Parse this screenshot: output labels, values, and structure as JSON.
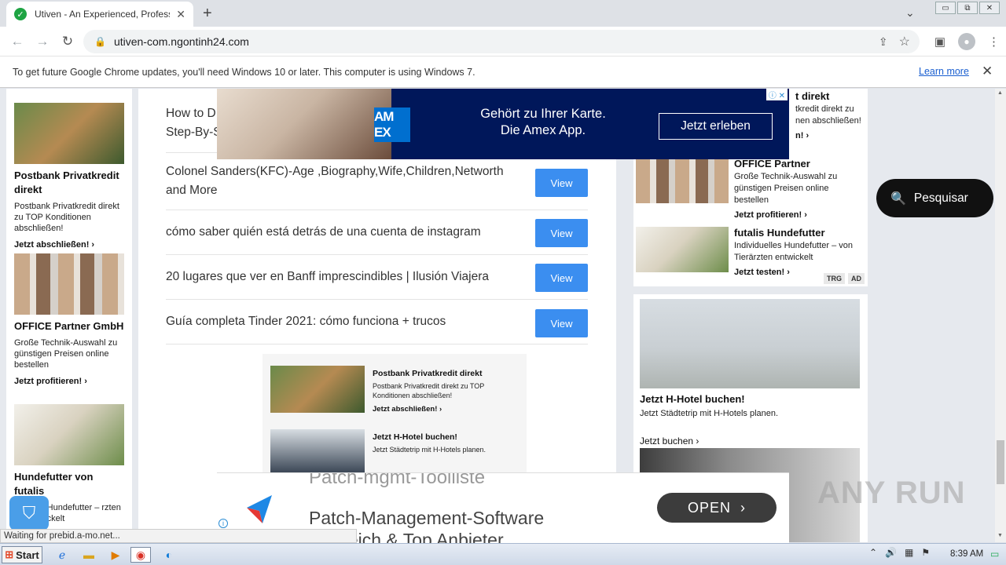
{
  "browser": {
    "tab_title": "Utiven - An Experienced, Profession",
    "url": "utiven-com.ngontinh24.com",
    "win_minimize": "▭",
    "win_restore": "⧉",
    "win_close": "✕"
  },
  "infobar": {
    "message": "To get future Google Chrome updates, you'll need Windows 10 or later. This computer is using Windows 7.",
    "learn_more": "Learn more"
  },
  "articles": [
    {
      "title": "How to D\nStep-By-S",
      "button": "View"
    },
    {
      "title": "Colonel Sanders(KFC)-Age ,Biography,Wife,Children,Networth and More",
      "button": "View"
    },
    {
      "title": "cómo saber quién está detrás de una cuenta de instagram",
      "button": "View"
    },
    {
      "title": "20 lugares que ver en Banff imprescindibles | Ilusión Viajera",
      "button": "View"
    },
    {
      "title": "Guía completa Tinder 2021: cómo funciona + trucos",
      "button": "View"
    }
  ],
  "left_ads": [
    {
      "heading": "Postbank Privatkredit direkt",
      "desc": "Postbank Privatkredit direkt zu TOP Konditionen abschließen!",
      "cta": "Jetzt abschließen!  ›"
    },
    {
      "heading": "OFFICE Partner GmbH",
      "desc": "Große Technik-Auswahl zu günstigen Preisen online bestellen",
      "cta": "Jetzt profitieren!  ›"
    },
    {
      "heading": "Hundefutter von futalis",
      "desc": "elles Hundefutter – rzten entwickelt",
      "cta": ""
    }
  ],
  "inline_ads": [
    {
      "heading": "Postbank Privatkredit direkt",
      "desc": "Postbank Privatkredit direkt zu TOP Konditionen abschließen!",
      "cta": "Jetzt abschließen!  ›"
    },
    {
      "heading": "Jetzt H-Hotel buchen!",
      "desc": "Jetzt Städtetrip mit H-Hotels planen.",
      "cta": ""
    }
  ],
  "right_ads": [
    {
      "heading": "t direkt",
      "desc": "tkredit direkt zu nen abschließen!",
      "cta": "n!  ›"
    },
    {
      "heading": "OFFICE Partner",
      "desc": "Große Technik-Auswahl zu günstigen Preisen online bestellen",
      "cta": "Jetzt profitieren!  ›"
    },
    {
      "heading": "futalis Hundefutter",
      "desc": "Individuelles Hundefutter – von Tierärzten entwickelt",
      "cta": "Jetzt testen!  ›"
    }
  ],
  "trg_labels": [
    "TRG",
    "AD"
  ],
  "hotel_ad": {
    "heading": "Jetzt H-Hotel buchen!",
    "desc": "Jetzt Städtetrip mit H-Hotels planen.",
    "cta": "Jetzt buchen  ›"
  },
  "amex_ad": {
    "logo": "AM EX",
    "line1": "Gehört zu Ihrer Karte.",
    "line2": "Die Amex App.",
    "cta": "Jetzt erleben"
  },
  "search_button": "Pesquisar",
  "patch_ad": {
    "ghost": "Patch-mgmt-Toolliste",
    "title": "Patch-Management-Software",
    "subtitle": "vergleich & Top Anbieter",
    "cta": "OPEN"
  },
  "watermark": "ANY RUN",
  "status_text": "Waiting for prebid.a-mo.net...",
  "taskbar": {
    "start": "Start",
    "clock": "8:39 AM"
  },
  "colors": {
    "view_button": "#3b8ef0",
    "amex_bg": "#00175a",
    "favicon": "#1ea443"
  }
}
